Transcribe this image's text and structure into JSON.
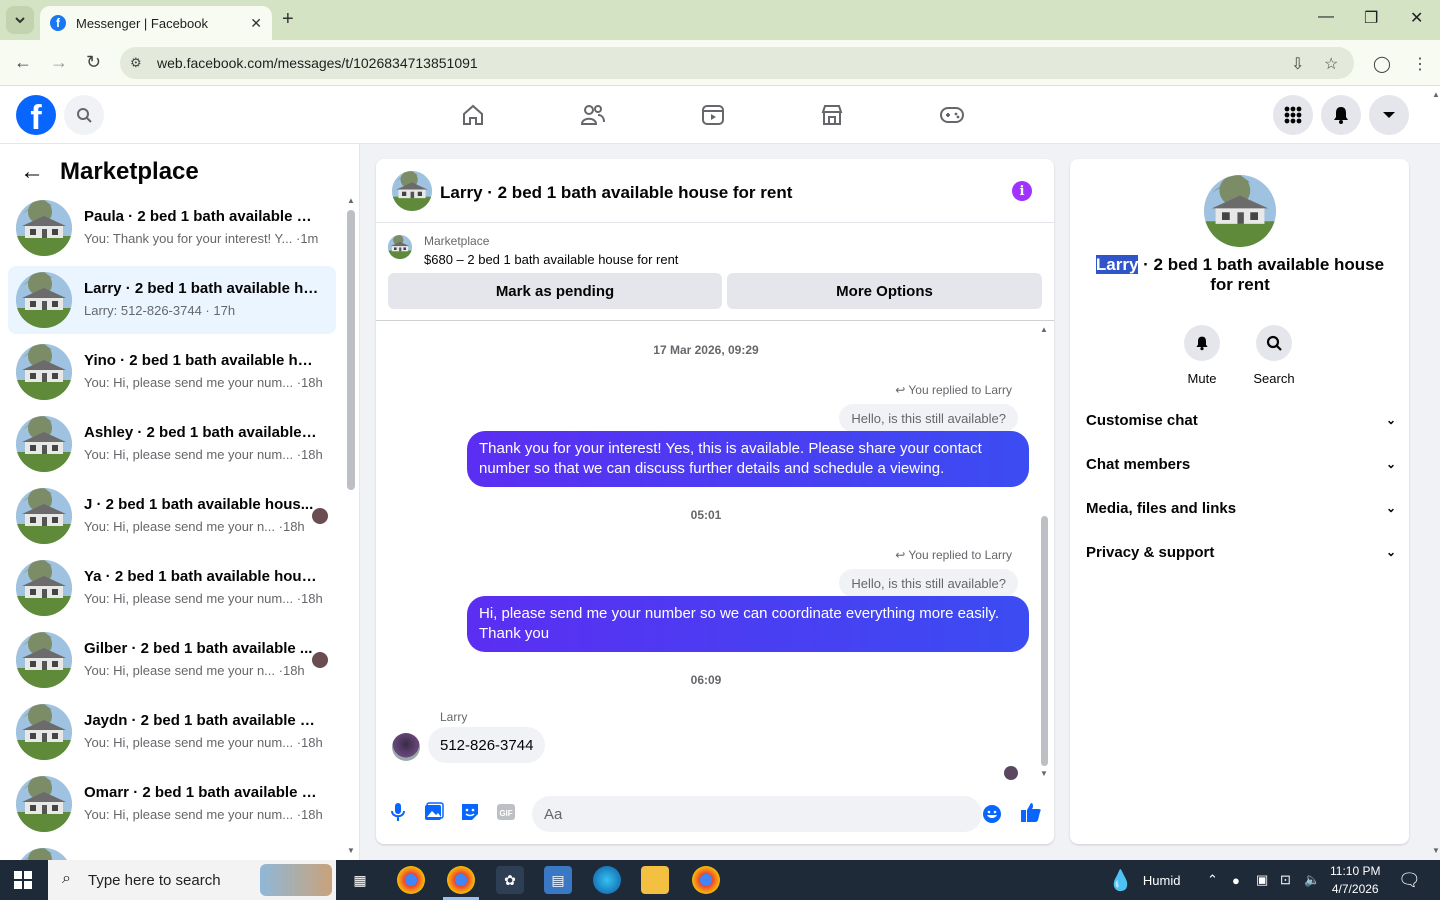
{
  "browser": {
    "tab_title": "Messenger | Facebook",
    "url": "web.facebook.com/messages/t/1026834713851091"
  },
  "left": {
    "title": "Marketplace",
    "conversations": [
      {
        "name": "Paula · 2 bed 1 bath available ho...",
        "preview": "You: Thank you for your interest! Y... ·1m",
        "active": false
      },
      {
        "name": "Larry · 2 bed 1 bath available ho...",
        "preview": "Larry: 512-826-3744 · 17h",
        "active": true
      },
      {
        "name": "Yino · 2 bed 1 bath available hou...",
        "preview": "You: Hi, please send me your num... ·18h",
        "active": false
      },
      {
        "name": "Ashley · 2 bed 1 bath available h...",
        "preview": "You: Hi, please send me your num... ·18h",
        "active": false
      },
      {
        "name": "J · 2 bed 1 bath available hous...",
        "preview": "You: Hi, please send me your n... ·18h",
        "active": false
      },
      {
        "name": "Ya · 2 bed 1 bath available house...",
        "preview": "You: Hi, please send me your num... ·18h",
        "active": false
      },
      {
        "name": "Gilber · 2 bed 1 bath available ...",
        "preview": "You: Hi, please send me your n... ·18h",
        "active": false
      },
      {
        "name": "Jaydn · 2 bed 1 bath available ho...",
        "preview": "You: Hi, please send me your num... ·18h",
        "active": false
      },
      {
        "name": "Omarr · 2 bed 1 bath available h...",
        "preview": "You: Hi, please send me your num... ·18h",
        "active": false
      }
    ]
  },
  "chat": {
    "title": "Larry · 2 bed 1 bath available house for rent",
    "marketplace_label": "Marketplace",
    "listing": "$680 – 2 bed 1 bath available house for rent",
    "btn_pending": "Mark as pending",
    "btn_more": "More Options",
    "ts1": "17 Mar 2026, 09:29",
    "replied1": "You replied to Larry",
    "quote1": "Hello, is this still available?",
    "msg1": "Thank you for your interest! Yes, this is available. Please share your contact number so that we can discuss further details and schedule a viewing.",
    "ts2": "05:01",
    "replied2": "You replied to Larry",
    "quote2": "Hello, is this still available?",
    "msg2": "Hi, please send me your number so we can coordinate everything more easily. Thank you",
    "ts3": "06:09",
    "sender": "Larry",
    "msg3": "512-826-3744",
    "composer_placeholder": "Aa"
  },
  "right": {
    "name_selected": "Larry",
    "name_rest": " · 2 bed 1 bath available house for rent",
    "mute": "Mute",
    "search": "Search",
    "rows": [
      "Customise chat",
      "Chat members",
      "Media, files and links",
      "Privacy & support"
    ]
  },
  "taskbar": {
    "search_placeholder": "Type here to search",
    "weather": "Humid",
    "time": "11:10 PM",
    "date": "4/7/2026"
  },
  "colors": {
    "fb_blue": "#0866ff",
    "bubble_out": "#4e3cf0",
    "info_purple": "#a033ff",
    "active_convo": "#ebf5ff"
  }
}
